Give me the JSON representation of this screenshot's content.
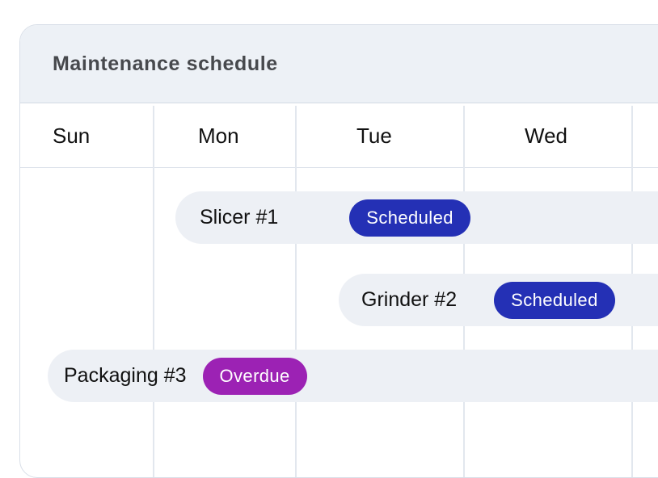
{
  "card": {
    "title": "Maintenance schedule"
  },
  "days": [
    {
      "label": "Sun"
    },
    {
      "label": "Mon"
    },
    {
      "label": "Tue"
    },
    {
      "label": "Wed"
    }
  ],
  "events": [
    {
      "name": "Slicer #1",
      "status": "Scheduled",
      "status_color": "#2430b5"
    },
    {
      "name": "Grinder #2",
      "status": "Scheduled",
      "status_color": "#2430b5"
    },
    {
      "name": "Packaging #3",
      "status": "Overdue",
      "status_color": "#9c22b4"
    }
  ],
  "colors": {
    "header_bg": "#edf1f6",
    "title_text": "#47494d",
    "event_bg": "#edf0f5",
    "scheduled": "#2430b5",
    "overdue": "#9c22b4"
  }
}
